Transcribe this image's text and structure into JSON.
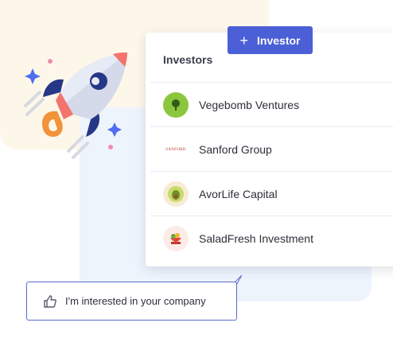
{
  "add_button": {
    "plus": "+",
    "label": "Investor"
  },
  "card": {
    "title": "Investors"
  },
  "investors": [
    {
      "name": "Vegebomb Ventures",
      "logo": "vegebomb-logo",
      "color": "#8cc63f"
    },
    {
      "name": "Sanford Group",
      "logo": "sanford-logo",
      "logo_text": "SANFORD",
      "color": "#b03a3a"
    },
    {
      "name": "AvorLife Capital",
      "logo": "avorlife-logo",
      "color": "#c9d96b"
    },
    {
      "name": "SaladFresh Investment",
      "logo": "saladfresh-logo",
      "color": "#e0463c"
    }
  ],
  "interest": {
    "label": "I'm interested in your company",
    "icon": "thumbs-up-icon"
  },
  "colors": {
    "accent": "#4b5fd6",
    "cream": "#fdf7ea",
    "light_blue": "#eef4fc"
  }
}
